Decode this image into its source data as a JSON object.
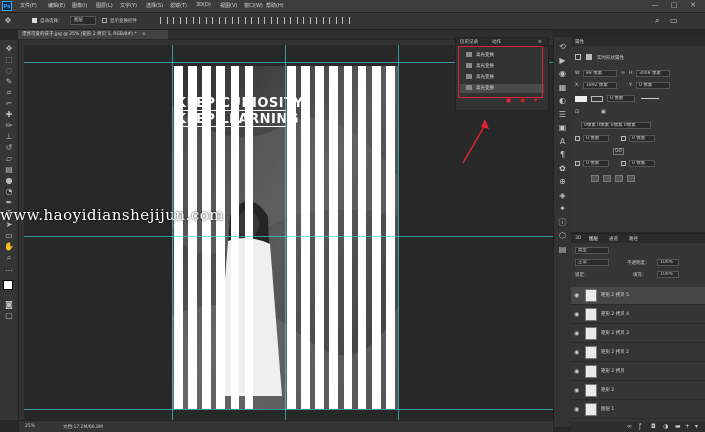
{
  "app": {
    "logo": "Ps"
  },
  "menu": [
    "文件(F)",
    "编辑(E)",
    "图像(I)",
    "图层(L)",
    "文字(Y)",
    "选择(S)",
    "滤镜(T)",
    "3D(D)",
    "视图(V)",
    "窗口(W)",
    "帮助(H)"
  ],
  "window_controls": [
    "—",
    "□",
    "✕"
  ],
  "options_bar": {
    "auto_select_label": "自动选择：",
    "layer_dropdown": "图层",
    "show_transform_label": "显示变换控件"
  },
  "document_tab": {
    "title": "漂亮可爱的孩子.jpg @ 25% (矩形 2 拷贝 5, RGB/8#) *",
    "close": "×"
  },
  "canvas": {
    "headline_line1": "KEEP CURIOSITY",
    "headline_line2": "KEEP LEARNING",
    "watermark": "www.haoyidianshejijun.com",
    "stripe_count": 16
  },
  "history_panel": {
    "tabs": [
      "历史记录",
      "动作"
    ],
    "items": [
      "高光变换",
      "高光变换",
      "高光变换",
      "高光变换"
    ],
    "menu_icon": "≡"
  },
  "properties_panel": {
    "title": "属性",
    "subtitle": "实时形状属性",
    "w_label": "W:",
    "w_value": "88 像素",
    "h_label": "H:",
    "h_value": "3008 像素",
    "x_label": "X:",
    "x_value": "1892 像素",
    "y_label": "Y:",
    "y_value": "0 像素",
    "stroke_value": "0 像素",
    "corner_label": "0像素 0像素 0像素 0像素",
    "corner_values": [
      "0 像素",
      "0 像素",
      "0 像素",
      "0 像素"
    ],
    "link_label": "GO"
  },
  "layers_panel": {
    "tabs": [
      "3D",
      "图层",
      "通道",
      "路径"
    ],
    "kind_label": "类型",
    "blend_mode": "正常",
    "opacity_label": "不透明度：",
    "opacity_value": "100%",
    "lock_label": "锁定：",
    "fill_label": "填充：",
    "fill_value": "100%",
    "layers": [
      {
        "name": "矩形 2 拷贝 5",
        "selected": true
      },
      {
        "name": "矩形 2 拷贝 4",
        "selected": false
      },
      {
        "name": "矩形 2 拷贝 3",
        "selected": false
      },
      {
        "name": "矩形 2 拷贝 2",
        "selected": false
      },
      {
        "name": "矩形 2 拷贝",
        "selected": false
      },
      {
        "name": "矩形 2",
        "selected": false
      },
      {
        "name": "图层 1",
        "selected": false
      }
    ]
  },
  "status_bar": {
    "zoom": "25%",
    "doc_info": "文档:17.2M/66.8M"
  },
  "colors": {
    "accent_red": "#d8252f",
    "guide_cyan": "#3fd6d6",
    "panel": "#353535"
  }
}
